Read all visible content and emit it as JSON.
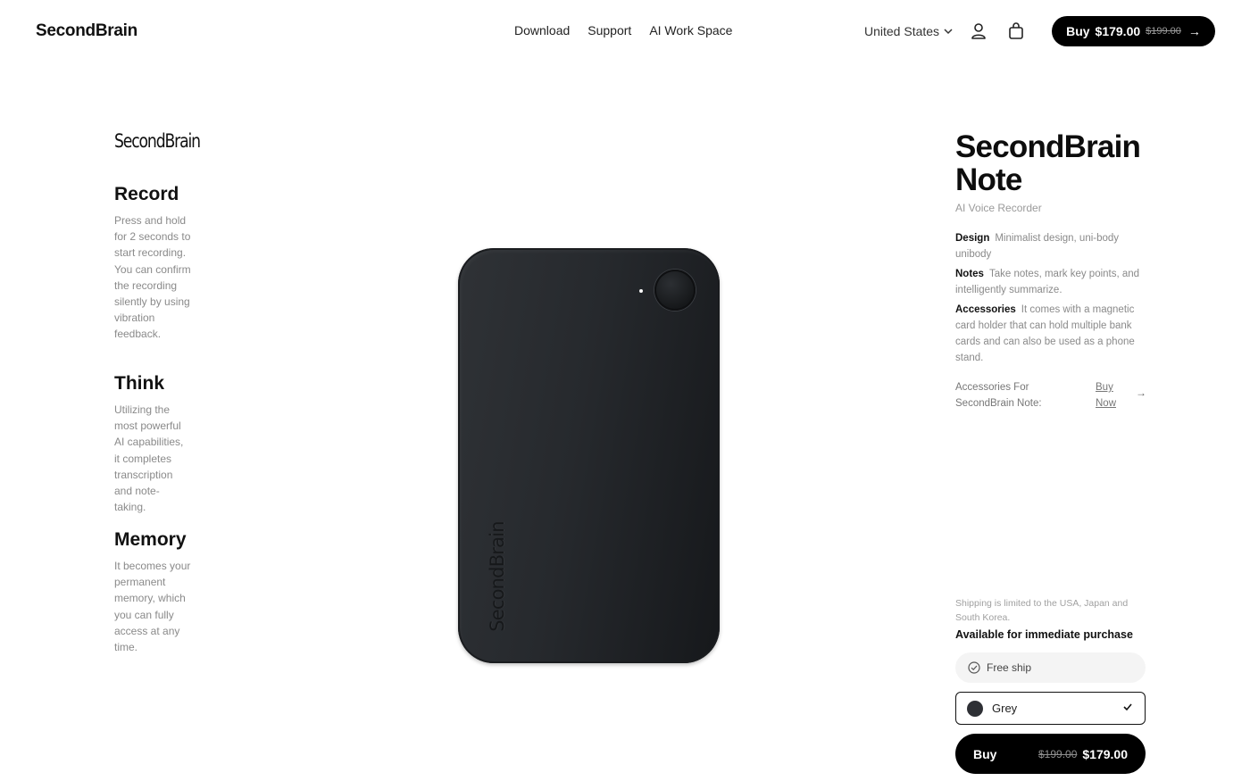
{
  "header": {
    "brand": "SecondBrain",
    "nav": [
      "Download",
      "Support",
      "AI Work Space"
    ],
    "region": "United States",
    "buy": {
      "label": "Buy",
      "price": "$179.00",
      "old_price": "$199.00",
      "arrow": "→"
    }
  },
  "left": {
    "logo": "SecondBrain",
    "features": [
      {
        "title": "Record",
        "text": "Press and hold for 2 seconds to start recording. You can confirm the recording silently by using vibration feedback."
      },
      {
        "title": "Think",
        "text": "Utilizing the most powerful AI capabilities, it completes transcription and note-taking."
      },
      {
        "title": "Memory",
        "text": "It becomes your permanent memory, which you can fully access at any time."
      }
    ]
  },
  "device": {
    "engraving": "SecondBrain",
    "colors": {
      "body": "#26292d"
    }
  },
  "product": {
    "title": "SecondBrain Note",
    "subtitle": "AI Voice Recorder",
    "specs": [
      {
        "label": "Design",
        "text": "Minimalist design, uni-body unibody"
      },
      {
        "label": "Notes",
        "text": "Take notes, mark key points, and intelligently summarize."
      },
      {
        "label": "Accessories",
        "text": "It comes with a magnetic card holder that can hold multiple bank cards and can also be used as a phone stand."
      }
    ],
    "accessories": {
      "label": "Accessories For SecondBrain Note:",
      "link": "Buy Now",
      "arrow": "→"
    },
    "shipping_note": "Shipping is limited to the USA, Japan and South Korea.",
    "availability": "Available for immediate purchase",
    "free_ship": "Free ship",
    "color": {
      "selected": "Grey",
      "swatch": "#2e3035"
    },
    "buy": {
      "label": "Buy",
      "old_price": "$199.00",
      "price": "$179.00"
    }
  }
}
